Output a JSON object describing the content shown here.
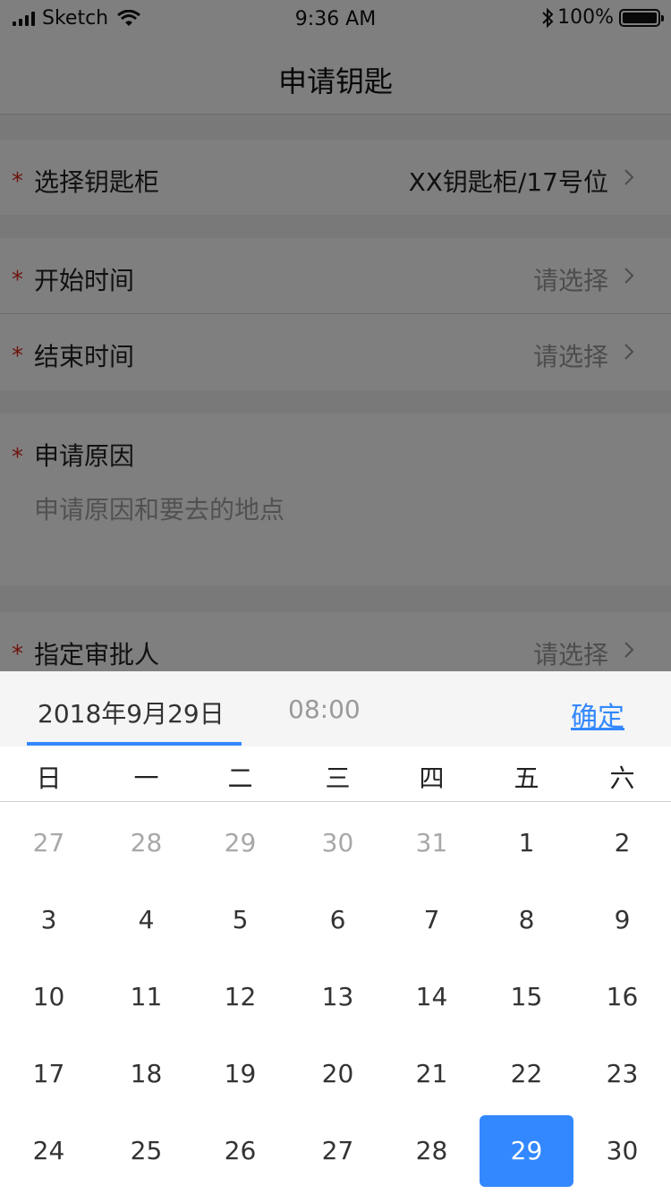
{
  "status_bar": {
    "carrier": "Sketch",
    "time": "9:36 AM",
    "battery": "100%",
    "battery_level": 1.0
  },
  "nav": {
    "title": "申请钥匙"
  },
  "form": {
    "required_mark": "*",
    "cabinet": {
      "label": "选择钥匙柜",
      "value": "XX钥匙柜/17号位"
    },
    "start_time": {
      "label": "开始时间",
      "value": "请选择"
    },
    "end_time": {
      "label": "结束时间",
      "value": "请选择"
    },
    "reason": {
      "label": "申请原因",
      "placeholder": "申请原因和要去的地点"
    },
    "approver": {
      "label": "指定审批人",
      "value": "请选择"
    }
  },
  "picker": {
    "date_tab": "2018年9月29日",
    "time_tab": "08:00",
    "confirm": "确定",
    "accent_color": "#3388ff",
    "weekdays": [
      "日",
      "一",
      "二",
      "三",
      "四",
      "五",
      "六"
    ],
    "weeks": [
      [
        "27",
        "28",
        "29",
        "30",
        "31",
        "1",
        "2"
      ],
      [
        "3",
        "4",
        "5",
        "6",
        "7",
        "8",
        "9"
      ],
      [
        "10",
        "11",
        "12",
        "13",
        "14",
        "15",
        "16"
      ],
      [
        "17",
        "18",
        "19",
        "20",
        "21",
        "22",
        "23"
      ],
      [
        "24",
        "25",
        "26",
        "27",
        "28",
        "29",
        "30"
      ]
    ],
    "muted_days": [
      "27",
      "28",
      "29",
      "30",
      "31"
    ],
    "selected_day": "29"
  }
}
